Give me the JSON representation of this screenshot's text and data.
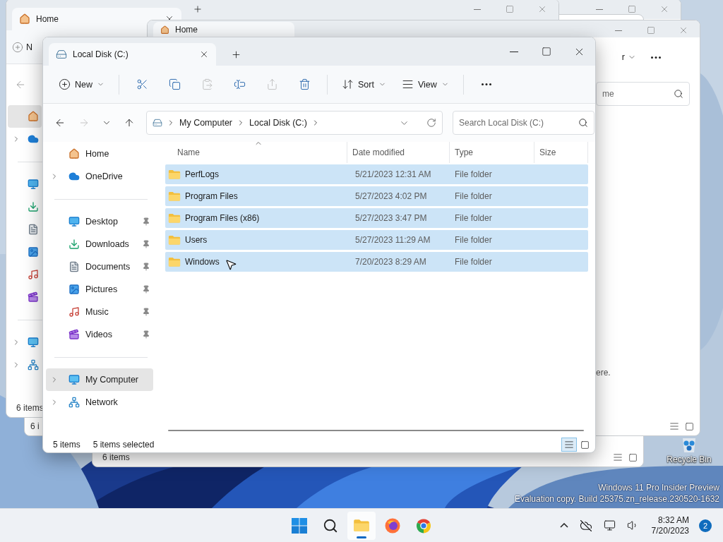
{
  "desktop": {
    "icons": [
      {
        "label": "Recycle Bin"
      }
    ],
    "watermark": [
      "Windows 11 Pro Insider Preview",
      "Evaluation copy. Build 25375.zn_release.230520-1632"
    ]
  },
  "background_windows": [
    {
      "kind": "controls_only"
    },
    {
      "kind": "status_only",
      "status": "6 i"
    },
    {
      "kind": "status_view",
      "status": "6 items"
    },
    {
      "kind": "nav",
      "tab": "Home",
      "toolbar_fragment": "N",
      "status": "6 items",
      "nav": [
        {
          "kind": "home",
          "selected": true
        },
        {
          "kind": "onedrive",
          "selected": false,
          "expanded": false
        },
        {
          "kind": "divider"
        },
        {
          "kind": "desktop",
          "selected": false
        },
        {
          "kind": "downloads",
          "selected": false
        },
        {
          "kind": "documents",
          "selected": false
        },
        {
          "kind": "pictures",
          "selected": false
        },
        {
          "kind": "music",
          "selected": false
        },
        {
          "kind": "videos",
          "selected": false
        },
        {
          "kind": "divider"
        },
        {
          "kind": "computer",
          "selected": false,
          "expanded": false
        },
        {
          "kind": "network",
          "selected": false,
          "expanded": false
        }
      ]
    },
    {
      "kind": "right_part",
      "tab": "Home",
      "toolbar_fragment": "r",
      "search_placeholder": "me",
      "message": "ere."
    }
  ],
  "window": {
    "tabs": [
      {
        "label": "Local Disk (C:)",
        "selected": true
      }
    ],
    "toolbar": [
      {
        "kind": "new",
        "label": "New",
        "disabled": false
      },
      {
        "kind": "separator"
      },
      {
        "kind": "cut",
        "disabled": false
      },
      {
        "kind": "copy",
        "disabled": false
      },
      {
        "kind": "paste",
        "disabled": true
      },
      {
        "kind": "rename",
        "disabled": false
      },
      {
        "kind": "share",
        "disabled": true
      },
      {
        "kind": "delete",
        "disabled": false
      },
      {
        "kind": "separator"
      },
      {
        "kind": "sort",
        "label": "Sort",
        "disabled": false
      },
      {
        "kind": "view",
        "label": "View",
        "disabled": false
      },
      {
        "kind": "separator"
      },
      {
        "kind": "more",
        "disabled": false
      }
    ],
    "nav_buttons": [
      {
        "kind": "back",
        "disabled": false
      },
      {
        "kind": "forward",
        "disabled": true
      },
      {
        "kind": "recent",
        "disabled": false
      },
      {
        "kind": "up",
        "disabled": false
      }
    ],
    "breadcrumb": [
      "My Computer",
      "Local Disk (C:)"
    ],
    "search": {
      "placeholder": "Search Local Disk (C:)"
    },
    "sidebar": {
      "groups": [
        [
          {
            "label": "Home",
            "kind": "home",
            "pinned": false,
            "selected": false
          },
          {
            "label": "OneDrive",
            "kind": "onedrive",
            "pinned": false,
            "selected": false,
            "expanded": false
          }
        ],
        [
          {
            "label": "Desktop",
            "kind": "desktop",
            "pinned": true,
            "selected": false
          },
          {
            "label": "Downloads",
            "kind": "downloads",
            "pinned": true,
            "selected": false
          },
          {
            "label": "Documents",
            "kind": "documents",
            "pinned": true,
            "selected": false
          },
          {
            "label": "Pictures",
            "kind": "pictures",
            "pinned": true,
            "selected": false
          },
          {
            "label": "Music",
            "kind": "music",
            "pinned": true,
            "selected": false
          },
          {
            "label": "Videos",
            "kind": "videos",
            "pinned": true,
            "selected": false
          }
        ],
        [
          {
            "label": "My Computer",
            "kind": "computer",
            "pinned": false,
            "selected": true,
            "expanded": false
          },
          {
            "label": "Network",
            "kind": "network",
            "pinned": false,
            "selected": false,
            "expanded": false
          }
        ]
      ]
    },
    "columns": [
      {
        "label": "Name",
        "sorted": true
      },
      {
        "label": "Date modified",
        "sorted": false
      },
      {
        "label": "Type",
        "sorted": false
      },
      {
        "label": "Size",
        "sorted": false
      }
    ],
    "rows": [
      {
        "name": "PerfLogs",
        "date": "5/21/2023 12:31 AM",
        "type": "File folder",
        "selected": true
      },
      {
        "name": "Program Files",
        "date": "5/27/2023 4:02 PM",
        "type": "File folder",
        "selected": true
      },
      {
        "name": "Program Files (x86)",
        "date": "5/27/2023 3:47 PM",
        "type": "File folder",
        "selected": true
      },
      {
        "name": "Users",
        "date": "5/27/2023 11:29 AM",
        "type": "File folder",
        "selected": true
      },
      {
        "name": "Windows",
        "date": "7/20/2023 8:29 AM",
        "type": "File folder",
        "selected": true
      }
    ],
    "status": {
      "count": "5 items",
      "selection": "5 items selected"
    },
    "view_modes": [
      {
        "kind": "details",
        "selected": true
      },
      {
        "kind": "tiles",
        "selected": false
      }
    ]
  },
  "taskbar": {
    "apps": [
      {
        "kind": "start",
        "selected": false
      },
      {
        "kind": "search",
        "selected": false
      },
      {
        "kind": "explorer",
        "selected": true
      },
      {
        "kind": "firefox",
        "selected": false
      },
      {
        "kind": "chrome",
        "selected": false
      }
    ],
    "tray": [
      {
        "kind": "chevron"
      },
      {
        "kind": "onedrive"
      },
      {
        "kind": "network"
      },
      {
        "kind": "volume"
      }
    ],
    "time": "8:32 AM",
    "date": "7/20/2023",
    "notifications": "2"
  }
}
